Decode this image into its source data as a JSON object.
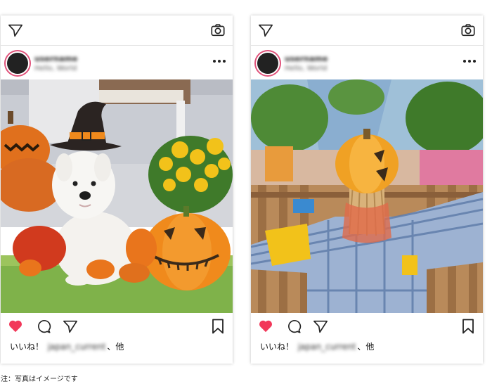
{
  "posts": [
    {
      "username": "username",
      "subtitle": "Hello, World",
      "likes_prefix": "いいね！",
      "liked_by": "japan_current",
      "likes_suffix": "、他",
      "photo": "westie-dog-halloween"
    },
    {
      "username": "username",
      "subtitle": "Hello, World",
      "likes_prefix": "いいね！",
      "liked_by": "japan_current",
      "likes_suffix": "、他",
      "photo": "pumpkin-scarecrow"
    }
  ],
  "icons": {
    "direct": "paper-plane-icon",
    "camera": "camera-icon",
    "more": "more-options-icon",
    "like": "heart-icon",
    "comment": "comment-bubble-icon",
    "share": "share-icon",
    "save": "bookmark-icon"
  },
  "colors": {
    "heart": "#f2385a",
    "avatar_ring": "#e0527a"
  },
  "footnote": "注：写真はイメージです"
}
